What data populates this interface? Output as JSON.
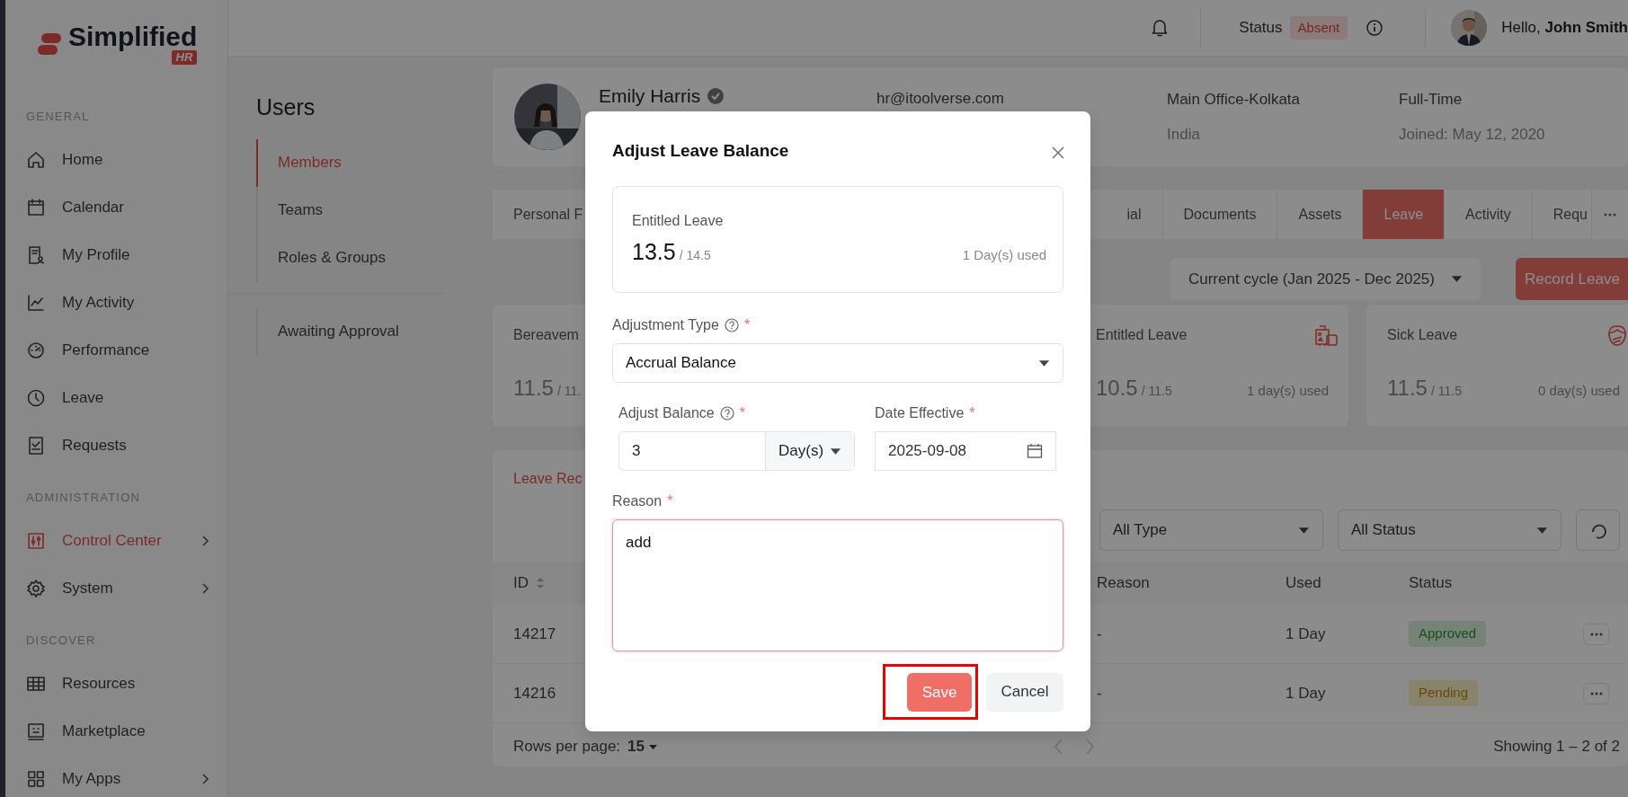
{
  "sidebar": {
    "logo": {
      "name": "Simplified",
      "tag": "HR"
    },
    "sections": [
      {
        "title": "GENERAL",
        "items": [
          {
            "label": "Home",
            "selected": false,
            "has_submenu": false
          },
          {
            "label": "Calendar",
            "selected": false,
            "has_submenu": false
          },
          {
            "label": "My Profile",
            "selected": false,
            "has_submenu": false
          },
          {
            "label": "My Activity",
            "selected": false,
            "has_submenu": false
          },
          {
            "label": "Performance",
            "selected": false,
            "has_submenu": false
          },
          {
            "label": "Leave",
            "selected": false,
            "has_submenu": false
          },
          {
            "label": "Requests",
            "selected": false,
            "has_submenu": false
          }
        ]
      },
      {
        "title": "ADMINISTRATION",
        "items": [
          {
            "label": "Control Center",
            "selected": true,
            "has_submenu": true
          },
          {
            "label": "System",
            "selected": false,
            "has_submenu": true
          }
        ]
      },
      {
        "title": "DISCOVER",
        "items": [
          {
            "label": "Resources",
            "selected": false,
            "has_submenu": false
          },
          {
            "label": "Marketplace",
            "selected": false,
            "has_submenu": false
          },
          {
            "label": "My Apps",
            "selected": false,
            "has_submenu": true
          }
        ]
      }
    ]
  },
  "header": {
    "status_label": "Status",
    "status": "Absent",
    "greeting": "Hello, **John Smith**"
  },
  "users_panel": {
    "title": "Users",
    "items": [
      {
        "label": "Members",
        "selected": true
      },
      {
        "label": "Teams",
        "selected": false
      },
      {
        "label": "Roles & Groups",
        "selected": false
      }
    ],
    "extra_items": [
      {
        "label": "Awaiting Approval",
        "selected": false
      }
    ]
  },
  "profile": {
    "name": "Emily Harris",
    "verified": true,
    "email": "hr@itoolverse.com",
    "office": "Main Office-Kolkata",
    "country": "India",
    "employment": "Full-Time",
    "joined": "Joined: May 12, 2020"
  },
  "tabs": [
    {
      "label": "Personal F",
      "selected": false
    },
    {
      "label": "ial",
      "selected": false
    },
    {
      "label": "Documents",
      "selected": false
    },
    {
      "label": "Assets",
      "selected": false
    },
    {
      "label": "Leave",
      "selected": true
    },
    {
      "label": "Activity",
      "selected": false
    },
    {
      "label": "Requ",
      "selected": false
    }
  ],
  "cycle": "Current cycle (Jan 2025 - Dec 2025)",
  "record_button": "Record Leave",
  "leave_cards": [
    {
      "title": "Bereavem",
      "value": "11.5",
      "total": "/ 11."
    },
    {
      "title": "Entitled Leave",
      "value": "10.5",
      "total": "/ 11.5",
      "used": "1 day(s) used"
    },
    {
      "title": "Sick Leave",
      "value": "11.5",
      "total": "/ 11.5",
      "used": "0 day(s) used"
    }
  ],
  "records": {
    "title": "Leave Rec",
    "filters": [
      "All Type",
      "All Status"
    ],
    "columns": [
      "ID",
      "Reason",
      "Used",
      "Status"
    ],
    "rows": [
      {
        "id": "14217",
        "reason": "-",
        "used": "1 Day",
        "status": "Approved",
        "kind": "approved"
      },
      {
        "id": "14216",
        "reason": "-",
        "used": "1 Day",
        "status": "Pending",
        "kind": "pending"
      }
    ],
    "rows_per_page_label": "Rows per page:",
    "rows_per_page": "15",
    "showing": "Showing 1 – 2 of 2"
  },
  "modal": {
    "title": "Adjust Leave Balance",
    "summary": {
      "title": "Entitled Leave",
      "value": "13.5",
      "total": "/ 14.5",
      "used": "1 Day(s) used"
    },
    "adjustment_type": {
      "label": "Adjustment Type",
      "required_mark": "*",
      "value": "Accrual Balance"
    },
    "adjust_balance": {
      "label": "Adjust Balance",
      "required_mark": "*",
      "value": "3",
      "unit": "Day(s)"
    },
    "date_effective": {
      "label": "Date Effective",
      "required_mark": "*",
      "value": "2025-09-08"
    },
    "reason": {
      "label": "Reason",
      "required_mark": "*",
      "value": "add"
    },
    "buttons": [
      {
        "label": "Save",
        "kind": "primary",
        "highlighted": true
      },
      {
        "label": "Cancel",
        "kind": "secondary",
        "highlighted": false
      }
    ]
  }
}
